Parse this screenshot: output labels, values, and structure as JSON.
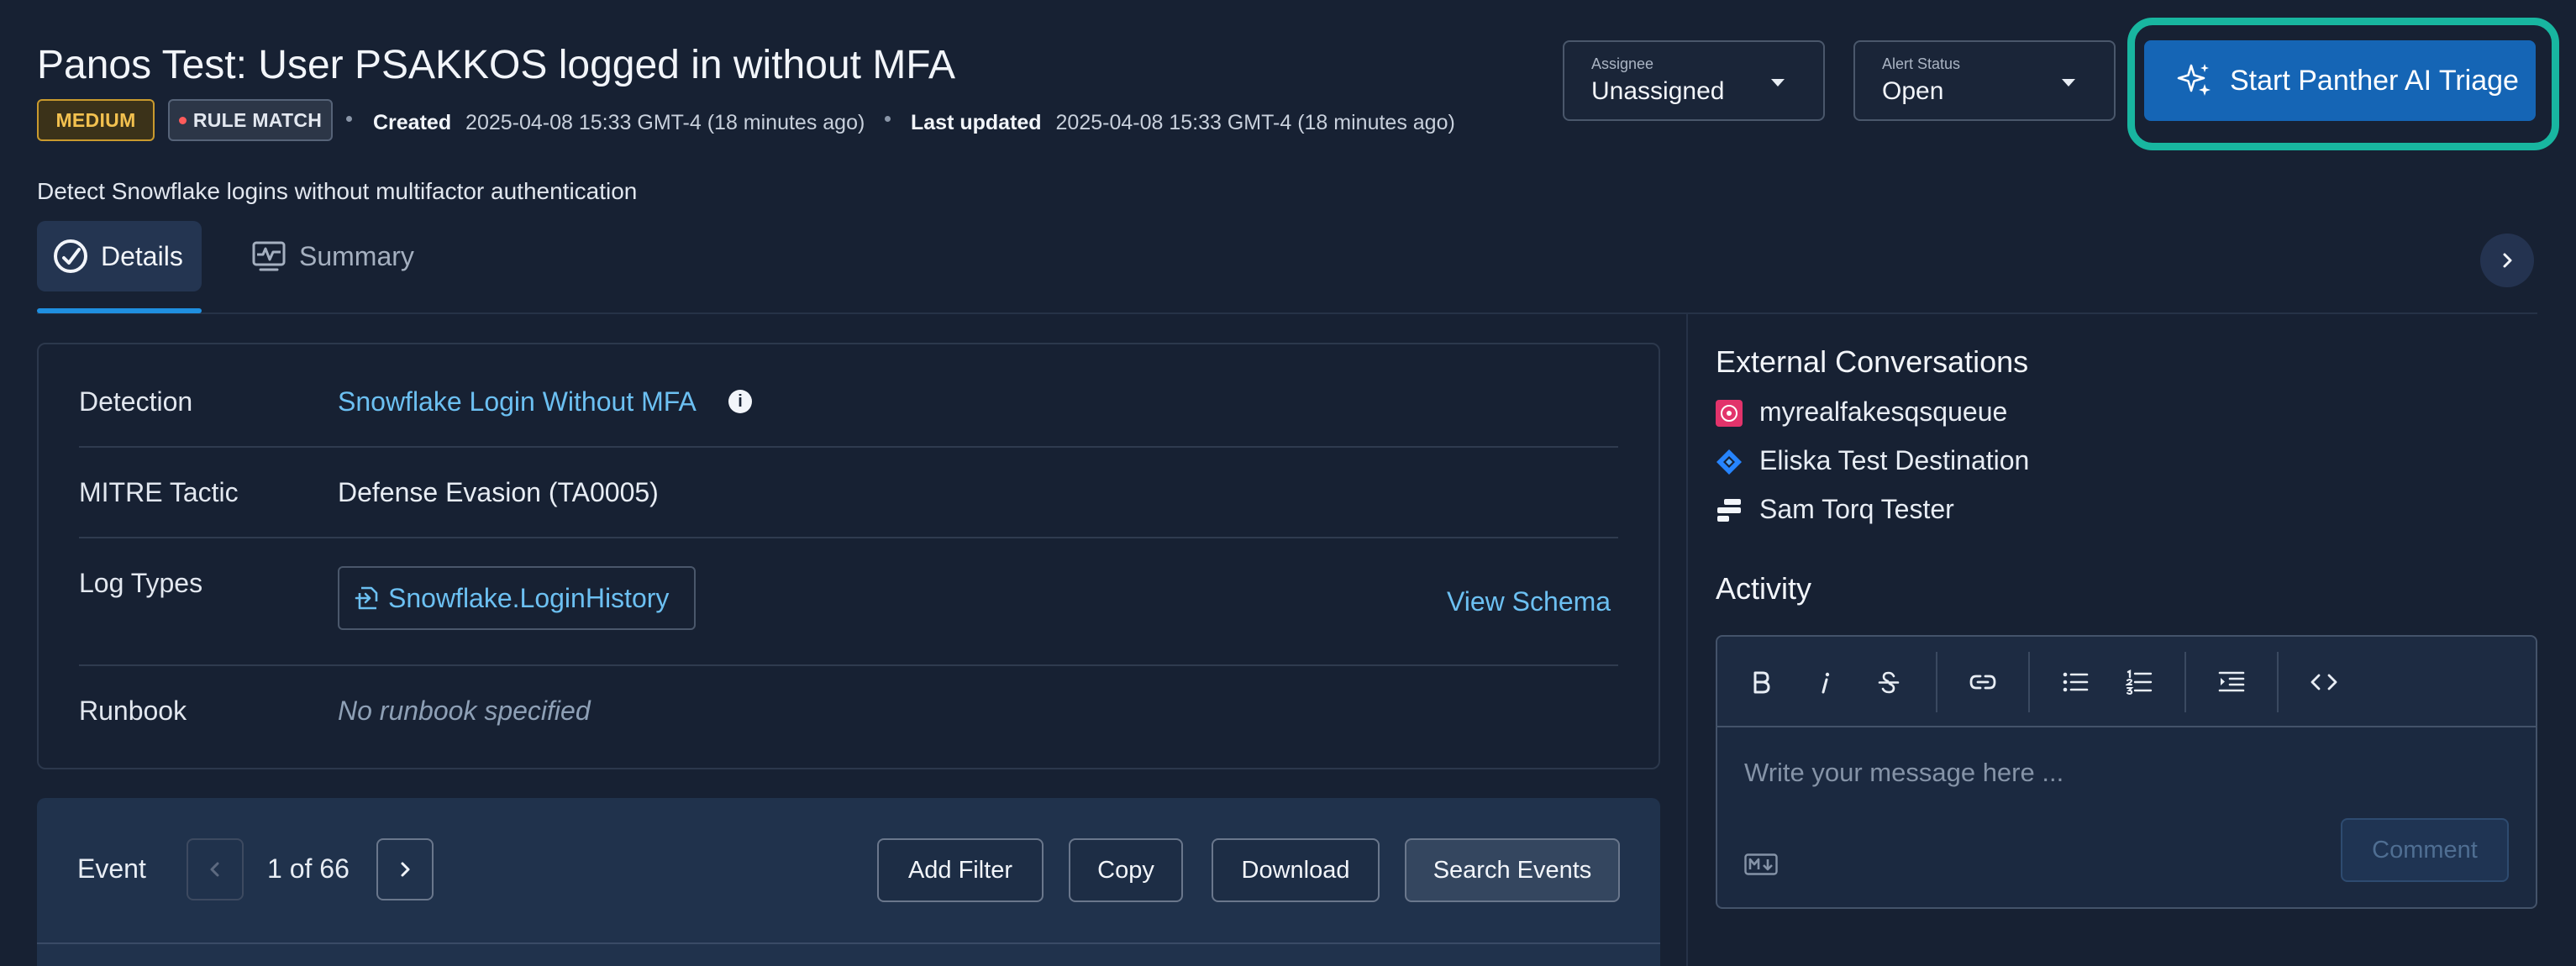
{
  "alert": {
    "title": "Panos Test: User PSAKKOS logged in without MFA",
    "severity": "MEDIUM",
    "type": "RULE MATCH",
    "created_label": "Created",
    "created_value": "2025-04-08 15:33 GMT-4 (18 minutes ago)",
    "updated_label": "Last updated",
    "updated_value": "2025-04-08 15:33 GMT-4 (18 minutes ago)",
    "description": "Detect Snowflake logins without multifactor authentication"
  },
  "assignee": {
    "label": "Assignee",
    "value": "Unassigned"
  },
  "alert_status": {
    "label": "Alert Status",
    "value": "Open"
  },
  "ai_triage": {
    "label": "Start Panther AI Triage"
  },
  "tabs": [
    {
      "label": "Details",
      "active": true
    },
    {
      "label": "Summary",
      "active": false
    }
  ],
  "details": {
    "detection_label": "Detection",
    "detection_value": "Snowflake Login Without MFA",
    "mitre_label": "MITRE Tactic",
    "mitre_value": "Defense Evasion (TA0005)",
    "logtypes_label": "Log Types",
    "logtype_value": "Snowflake.LoginHistory",
    "view_schema": "View Schema",
    "runbook_label": "Runbook",
    "runbook_value": "No runbook specified"
  },
  "event": {
    "label": "Event",
    "pagination": "1 of 66",
    "buttons": [
      "Add Filter",
      "Copy",
      "Download",
      "Search Events"
    ]
  },
  "external_conversations": {
    "title": "External Conversations",
    "items": [
      {
        "name": "myrealfakesqsqueue",
        "icon": "sqs-icon"
      },
      {
        "name": "Eliska Test Destination",
        "icon": "jira-icon"
      },
      {
        "name": "Sam Torq Tester",
        "icon": "torq-icon"
      }
    ]
  },
  "activity": {
    "title": "Activity",
    "placeholder": "Write your message here ...",
    "comment_button": "Comment",
    "toolbar": [
      "bold",
      "italic",
      "strikethrough",
      "link",
      "bullet-list",
      "numbered-list",
      "indent",
      "code"
    ]
  },
  "colors": {
    "background": "#172133",
    "accent": "#1565b5",
    "highlight_ring": "#18b6a0",
    "link": "#6cc0f2",
    "medium": "#f3c14f"
  }
}
